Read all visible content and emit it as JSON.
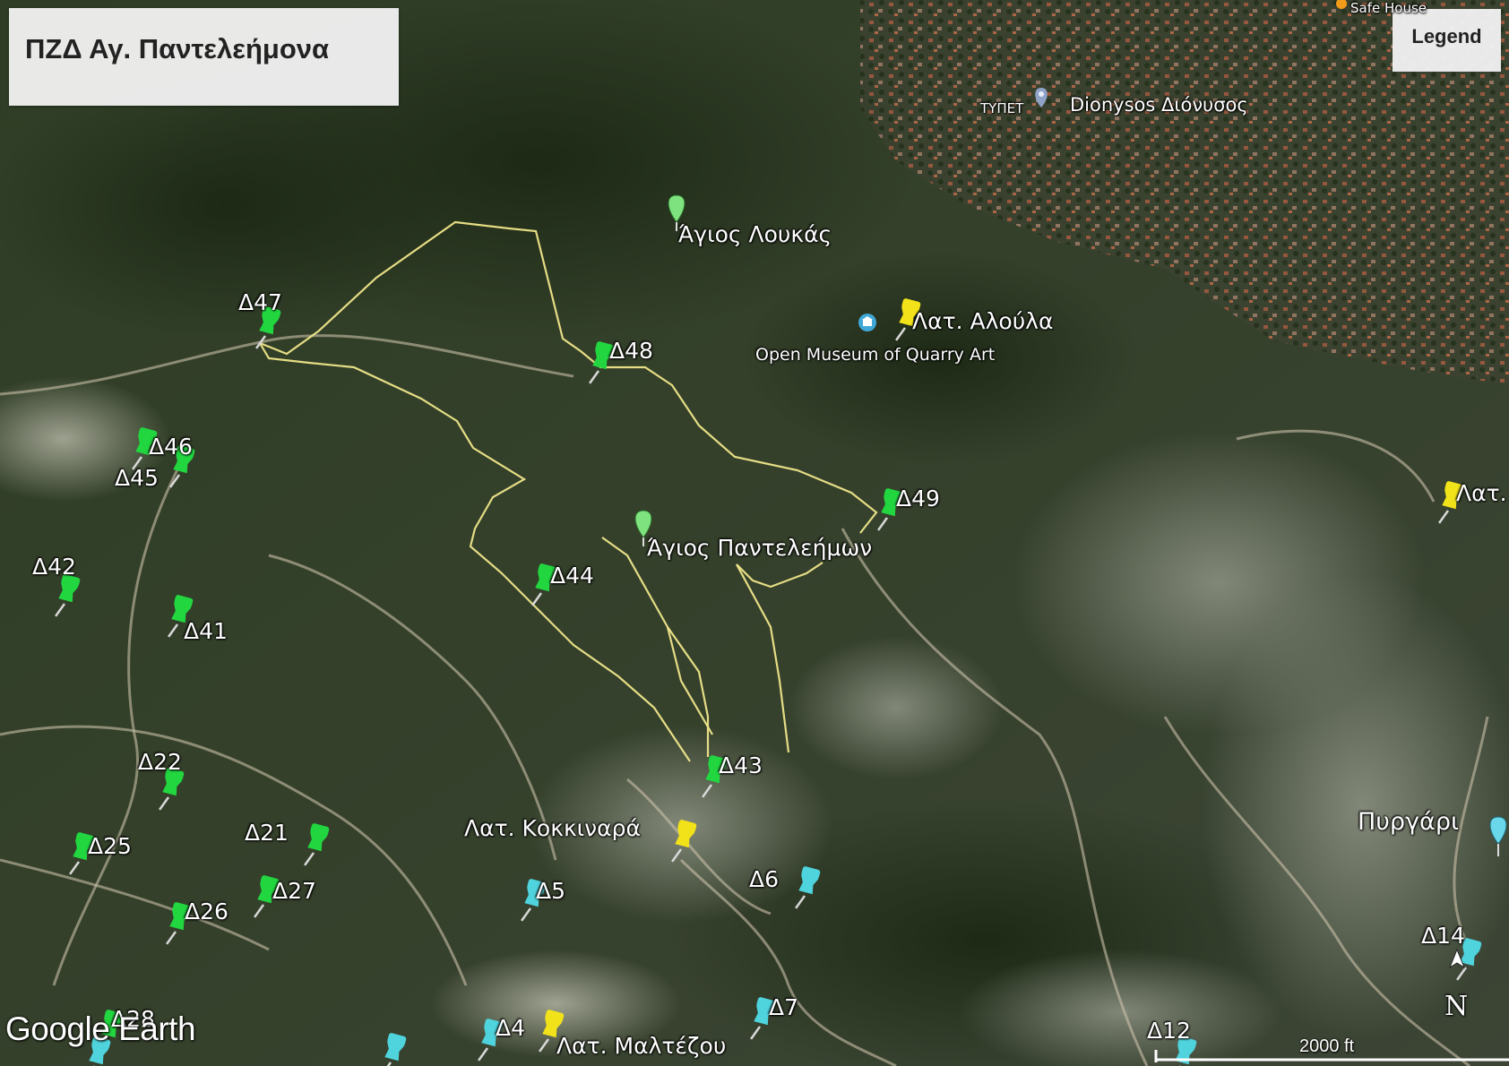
{
  "app": {
    "brand": "Google Earth"
  },
  "title": "ΠΖΔ Αγ. Παντελεήμονα",
  "legend_label": "Legend",
  "scale": {
    "label": "2000 ft"
  },
  "compass_label": "N",
  "places": [
    {
      "id": "agios-loukas",
      "text": "Άγιος Λουκάς"
    },
    {
      "id": "agios-panteleimon",
      "text": "Άγιος Παντελεήμων"
    },
    {
      "id": "lat-aloula",
      "text": "Λατ.  Αλούλα"
    },
    {
      "id": "open-museum",
      "text": "Open Museum of Quarry Art"
    },
    {
      "id": "dionysos",
      "text": "Dionysos Διόνυσος"
    },
    {
      "id": "typet",
      "text": "ΤΥΠΕΤ"
    },
    {
      "id": "safe-house",
      "text": "Safe House"
    },
    {
      "id": "lat-right",
      "text": "Λατ."
    },
    {
      "id": "pyrgari",
      "text": "Πυργάρι"
    },
    {
      "id": "lat-kokkinara",
      "text": "Λατ. Κοκκιναρά"
    },
    {
      "id": "lat-maltezou",
      "text": "Λατ.  Μαλτέζου"
    }
  ],
  "pins": [
    {
      "id": "d47",
      "text": "Δ47",
      "color": "green"
    },
    {
      "id": "d48",
      "text": "Δ48",
      "color": "green"
    },
    {
      "id": "d46",
      "text": "Δ46",
      "color": "green"
    },
    {
      "id": "d45",
      "text": "Δ45",
      "color": "green"
    },
    {
      "id": "d49",
      "text": "Δ49",
      "color": "green"
    },
    {
      "id": "d44",
      "text": "Δ44",
      "color": "green"
    },
    {
      "id": "d42",
      "text": "Δ42",
      "color": "green"
    },
    {
      "id": "d41",
      "text": "Δ41",
      "color": "green"
    },
    {
      "id": "d43",
      "text": "Δ43",
      "color": "green"
    },
    {
      "id": "d22",
      "text": "Δ22",
      "color": "green"
    },
    {
      "id": "d21",
      "text": "Δ21",
      "color": "green"
    },
    {
      "id": "d25",
      "text": "Δ25",
      "color": "green"
    },
    {
      "id": "d27",
      "text": "Δ27",
      "color": "green"
    },
    {
      "id": "d26",
      "text": "Δ26",
      "color": "green"
    },
    {
      "id": "d28",
      "text": "Δ28",
      "color": "green"
    },
    {
      "id": "d5",
      "text": "Δ5",
      "color": "cyan"
    },
    {
      "id": "d6",
      "text": "Δ6",
      "color": "cyan"
    },
    {
      "id": "d7",
      "text": "Δ7",
      "color": "cyan"
    },
    {
      "id": "d4",
      "text": "Δ4",
      "color": "cyan"
    },
    {
      "id": "d12",
      "text": "Δ12",
      "color": "cyan"
    },
    {
      "id": "d14",
      "text": "Δ14",
      "color": "cyan"
    }
  ],
  "colors": {
    "green_pin": "#22d640",
    "yellow_pin": "#f2e21a",
    "cyan_pin": "#4fd3dc",
    "route": "#efe68a"
  }
}
